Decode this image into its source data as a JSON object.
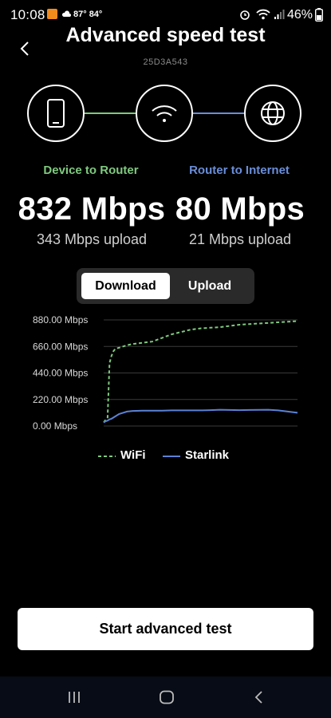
{
  "status_bar": {
    "time": "10:08",
    "temperature": "87° 84°",
    "battery_pct": "46%"
  },
  "header": {
    "title": "Advanced speed test",
    "serial": "25D3A543"
  },
  "topology": {
    "nodes": [
      "phone-icon",
      "wifi-icon",
      "globe-icon"
    ],
    "colors": {
      "device_link": "#7fc97f",
      "internet_link": "#6a8ed9"
    }
  },
  "segments": {
    "device_to_router": {
      "label": "Device to Router",
      "download": "832 Mbps",
      "upload": "343 Mbps upload",
      "color": "#7fc97f"
    },
    "router_to_internet": {
      "label": "Router to Internet",
      "download": "80 Mbps",
      "upload": "21 Mbps upload",
      "color": "#6a8ed9"
    }
  },
  "toggle": {
    "download_label": "Download",
    "upload_label": "Upload",
    "selected": "Download"
  },
  "chart_data": {
    "type": "line",
    "title": "",
    "xlabel": "",
    "ylabel": "",
    "ylim": [
      0,
      880
    ],
    "y_ticks": [
      "880.00 Mbps",
      "660.00 Mbps",
      "440.00 Mbps",
      "220.00 Mbps",
      "0.00 Mbps"
    ],
    "y_tick_values": [
      880,
      660,
      440,
      220,
      0
    ],
    "grid": true,
    "legend_position": "bottom",
    "x": [
      0,
      1,
      2,
      3,
      4,
      5,
      6,
      8,
      10,
      12,
      15,
      20,
      25,
      30,
      35,
      40,
      45,
      50,
      55,
      60,
      65,
      70,
      75,
      80,
      85,
      90,
      95,
      100
    ],
    "series": [
      {
        "name": "WiFi",
        "style": "dashed",
        "color": "#7fc97f",
        "values": [
          30,
          50,
          70,
          520,
          580,
          620,
          640,
          650,
          660,
          670,
          680,
          690,
          700,
          730,
          760,
          780,
          800,
          810,
          815,
          820,
          830,
          840,
          845,
          850,
          855,
          860,
          865,
          870
        ]
      },
      {
        "name": "Starlink",
        "style": "solid",
        "color": "#5b82d6",
        "values": [
          30,
          40,
          45,
          55,
          60,
          70,
          80,
          100,
          110,
          120,
          125,
          128,
          128,
          128,
          130,
          130,
          130,
          130,
          132,
          135,
          133,
          132,
          133,
          134,
          135,
          130,
          120,
          110
        ]
      }
    ]
  },
  "actions": {
    "start_label": "Start advanced test"
  }
}
